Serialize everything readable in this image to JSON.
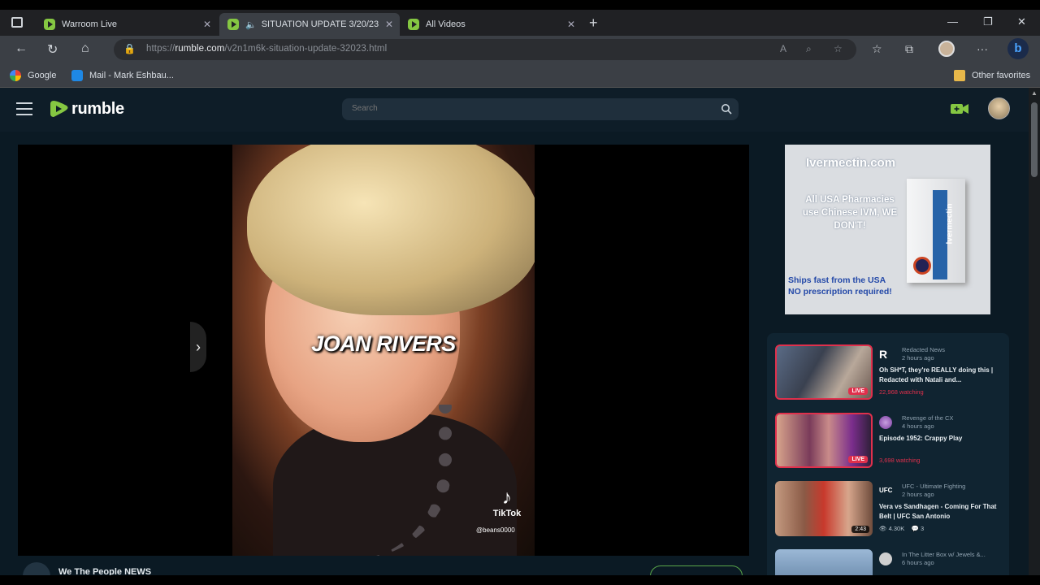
{
  "browser": {
    "tabs": [
      {
        "label": "Warroom Live",
        "active": false
      },
      {
        "label": "SITUATION UPDATE 3/20/23",
        "active": true
      },
      {
        "label": "All Videos",
        "active": false
      }
    ],
    "address": {
      "url_prefix": "https://",
      "url_domain": "rumble.com",
      "url_path": "/v2n1m6k-situation-update-32023.html"
    },
    "favorites": [
      {
        "label": "Google"
      },
      {
        "label": "Mail - Mark Eshbau..."
      }
    ],
    "other_favorites": "Other favorites"
  },
  "site": {
    "logo_text": "rumble",
    "search_placeholder": "Search",
    "accent_color": "#85c742"
  },
  "player": {
    "caption": "JOAN RIVERS",
    "watermark_brand": "TikTok",
    "watermark_handle": "@beans0000"
  },
  "channel": {
    "name": "We The People NEWS"
  },
  "ad": {
    "site": "Ivermectin.com",
    "body": "All USA Pharmacies use Chinese IVM, WE DON'T!",
    "product": "Ivermectin",
    "footer_line1": "Ships fast from the USA",
    "footer_line2": "NO prescription required!"
  },
  "related": [
    {
      "channel": "Redacted News",
      "ago": "2 hours ago",
      "title": "Oh SH*T, they're REALLY doing this | Redacted with Natali and...",
      "meta": "22,968 watching",
      "badge": "LIVE",
      "live": true
    },
    {
      "channel": "Revenge of the CX",
      "ago": "4 hours ago",
      "title": "Episode 1952: Crappy Play",
      "meta": "3,698 watching",
      "badge": "LIVE",
      "live": true
    },
    {
      "channel": "UFC - Ultimate Fighting",
      "ago": "2 hours ago",
      "title": "Vera vs Sandhagen - Coming For That Belt | UFC San Antonio",
      "views": "4.30K",
      "comments": "3",
      "badge": "2:43",
      "live": false
    },
    {
      "channel": "In The Litter Box w/ Jewels &...",
      "ago": "6 hours ago",
      "title": "",
      "meta": "",
      "badge": "",
      "live": false
    }
  ]
}
